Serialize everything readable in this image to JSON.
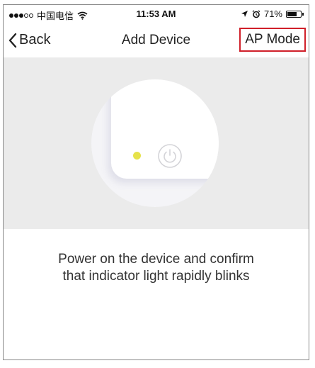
{
  "status_bar": {
    "carrier": "中国电信",
    "time": "11:53 AM",
    "battery_percent": "71%",
    "battery_level": 0.71,
    "icons": [
      "signal-dots-icon",
      "wifi-icon",
      "location-icon",
      "alarm-icon",
      "battery-icon"
    ]
  },
  "nav": {
    "back_label": "Back",
    "title": "Add Device",
    "ap_mode_label": "AP Mode",
    "highlight_color": "#d0202a"
  },
  "illustration": {
    "indicator_color": "#e6e24a",
    "icons": [
      "indicator-light",
      "power-icon"
    ]
  },
  "instruction": {
    "line1": "Power on the device and confirm",
    "line2": "that indicator light rapidly blinks"
  }
}
